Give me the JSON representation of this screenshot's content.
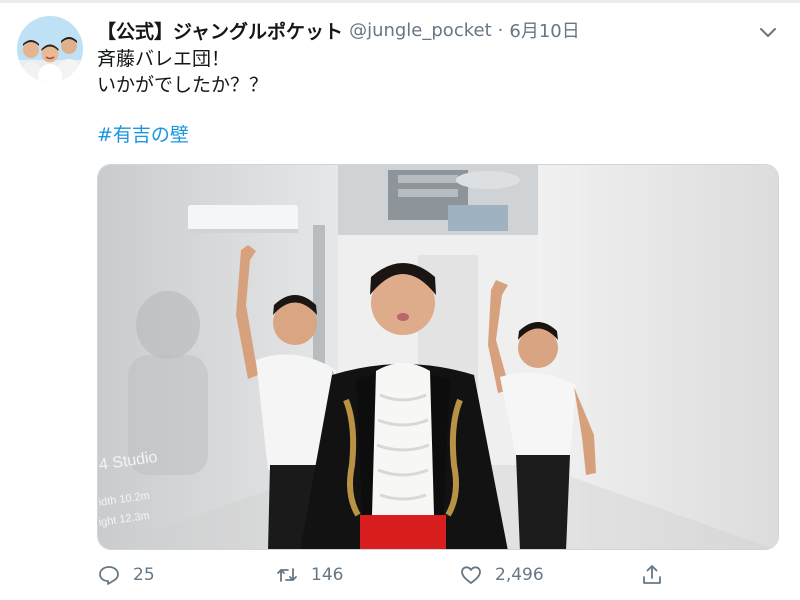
{
  "tweet": {
    "display_name": "【公式】ジャングルポケット",
    "handle": "@jungle_pocket",
    "separator": "·",
    "date": "6月10日",
    "text_lines": [
      "斉藤バレエ団！",
      "いかがでしたか？？"
    ],
    "hashtag": "#有吉の壁"
  },
  "media": {
    "overlay_studio": "4 Studio",
    "overlay_width": "idth 10.2m",
    "overlay_height": "ight 12.3m"
  },
  "actions": {
    "reply_count": "25",
    "retweet_count": "146",
    "like_count": "2,496"
  },
  "icons": {
    "reply": "reply-icon",
    "retweet": "retweet-icon",
    "like": "heart-icon",
    "share": "share-icon",
    "more": "chevron-down-icon"
  },
  "colors": {
    "link": "#1b95e0",
    "muted": "#657786",
    "text": "#14171a"
  }
}
